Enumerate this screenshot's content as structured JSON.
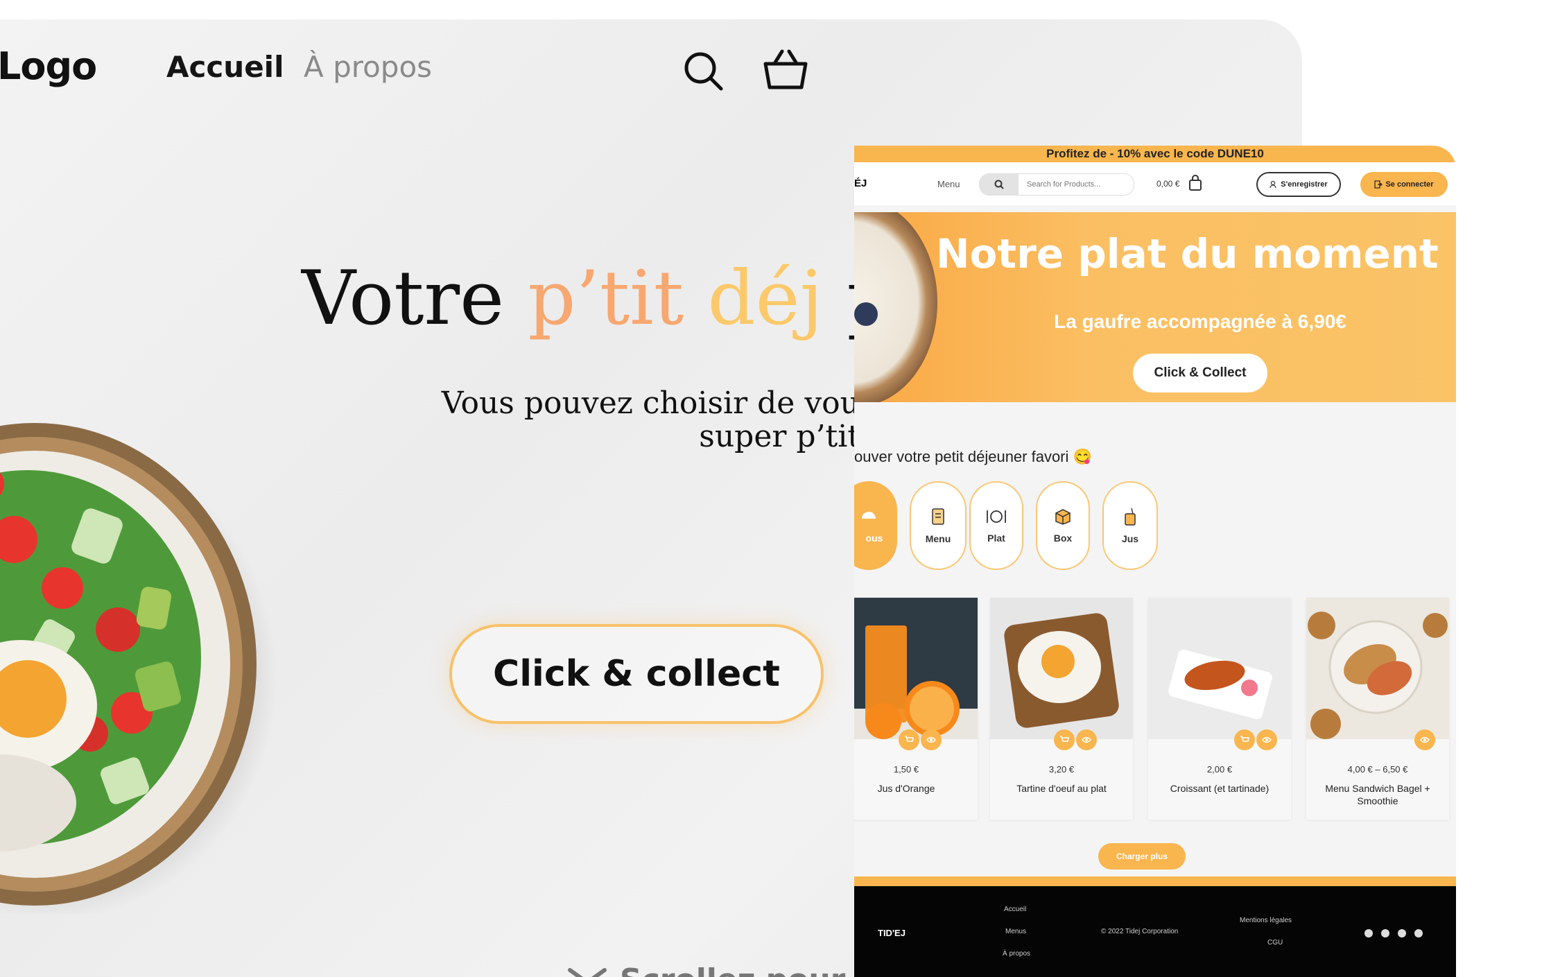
{
  "site_a": {
    "logo": "Logo",
    "nav": {
      "home": "Accueil",
      "about": "À propos"
    },
    "hero": {
      "w1": "Votre",
      "w2": "p’tit",
      "w3": "déj",
      "w4": "p",
      "sub_line1": "Vous pouvez choisir de vou",
      "sub_line2": "super p’tit"
    },
    "cta": "Click & collect",
    "scroll_hint": "Scrollez pour v",
    "colors": {
      "accent_orange": "#f7a770",
      "accent_yellow": "#fbc96a",
      "cta_border": "#f8c169"
    },
    "icons": [
      "search-icon",
      "basket-icon",
      "chevron-down-icon"
    ]
  },
  "site_b": {
    "promo": "Profitez de - 10% avec le code DUNE10",
    "brand": "ÉJ",
    "menu_link": "Menu",
    "search_placeholder": "Search for Products...",
    "cart_total": "0,00 €",
    "register": "S'enregistrer",
    "login": "Se connecter",
    "banner": {
      "title": "Notre plat du moment !",
      "subtitle": "La gaufre accompagnée à 6,90€",
      "button": "Click & Collect"
    },
    "section_title": "ouver votre petit déjeuner favori 😋",
    "categories": [
      {
        "label": "ous",
        "icon": "all-icon"
      },
      {
        "label": "Menu",
        "icon": "menu-icon"
      },
      {
        "label": "Plat",
        "icon": "plate-icon"
      },
      {
        "label": "Box",
        "icon": "box-icon"
      },
      {
        "label": "Jus",
        "icon": "juice-icon"
      }
    ],
    "products": [
      {
        "price": "1,50 €",
        "name": "Jus d'Orange"
      },
      {
        "price": "3,20 €",
        "name": "Tartine d'oeuf au plat"
      },
      {
        "price": "2,00 €",
        "name": "Croissant (et tartinade)"
      },
      {
        "price": "4,00 € – 6,50 €",
        "name": "Menu Sandwich Bagel + Smoothie"
      }
    ],
    "load_more": "Charger plus",
    "footer": {
      "brand": "TID'EJ",
      "links_col1": [
        "Accueil",
        "Menus",
        "À propos"
      ],
      "copyright": "© 2022 Tidej Corporation",
      "links_col3": [
        "Mentions légales",
        "CGU"
      ]
    },
    "colors": {
      "brand_orange": "#f9b54e",
      "footer_bg": "#050505"
    }
  }
}
